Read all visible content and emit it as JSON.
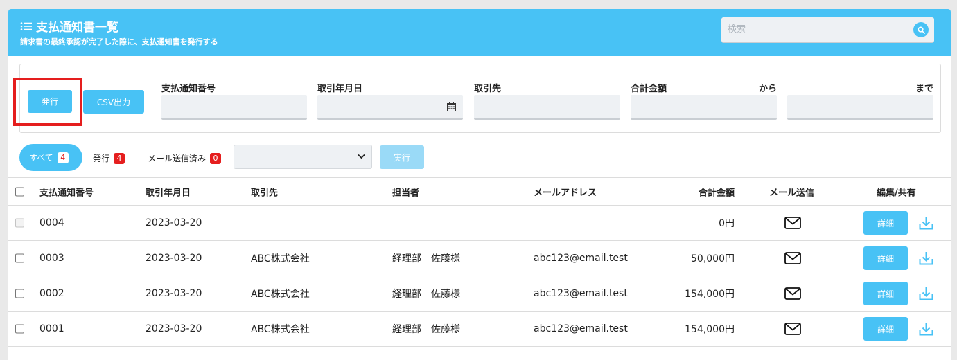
{
  "header": {
    "title": "支払通知書一覧",
    "subtitle": "請求書の最終承認が完了した際に、支払通知書を発行する",
    "search_placeholder": "検索"
  },
  "filters": {
    "issue_button": "発行",
    "csv_button": "CSV出力",
    "labels": {
      "number": "支払通知番号",
      "date": "取引年月日",
      "partner": "取引先",
      "amount": "合計金額",
      "from": "から",
      "to": "まで"
    }
  },
  "status_tabs": {
    "all_label": "すべて",
    "all_count": "4",
    "issued_label": "発行",
    "issued_count": "4",
    "mailed_label": "メール送信済み",
    "mailed_count": "0",
    "select_value": "",
    "run_button": "実行"
  },
  "table": {
    "headers": {
      "number": "支払通知番号",
      "date": "取引年月日",
      "partner": "取引先",
      "person": "担当者",
      "email": "メールアドレス",
      "amount": "合計金額",
      "mail": "メール送信",
      "edit": "編集/共有"
    },
    "detail_label": "詳細",
    "rows": [
      {
        "number": "0004",
        "date": "2023-03-20",
        "partner": "",
        "person": "",
        "email": "",
        "amount": "0円"
      },
      {
        "number": "0003",
        "date": "2023-03-20",
        "partner": "ABC株式会社",
        "person": "経理部　佐藤様",
        "email": "abc123@email.test",
        "amount": "50,000円"
      },
      {
        "number": "0002",
        "date": "2023-03-20",
        "partner": "ABC株式会社",
        "person": "経理部　佐藤様",
        "email": "abc123@email.test",
        "amount": "154,000円"
      },
      {
        "number": "0001",
        "date": "2023-03-20",
        "partner": "ABC株式会社",
        "person": "経理部　佐藤様",
        "email": "abc123@email.test",
        "amount": "154,000円"
      }
    ]
  },
  "colors": {
    "accent": "#48c2f5",
    "highlight": "#e51e1e",
    "badge": "#e51e1e"
  },
  "icons": [
    "list-icon",
    "search-icon",
    "calendar-icon",
    "chevron-down-icon",
    "mail-icon",
    "download-icon"
  ]
}
